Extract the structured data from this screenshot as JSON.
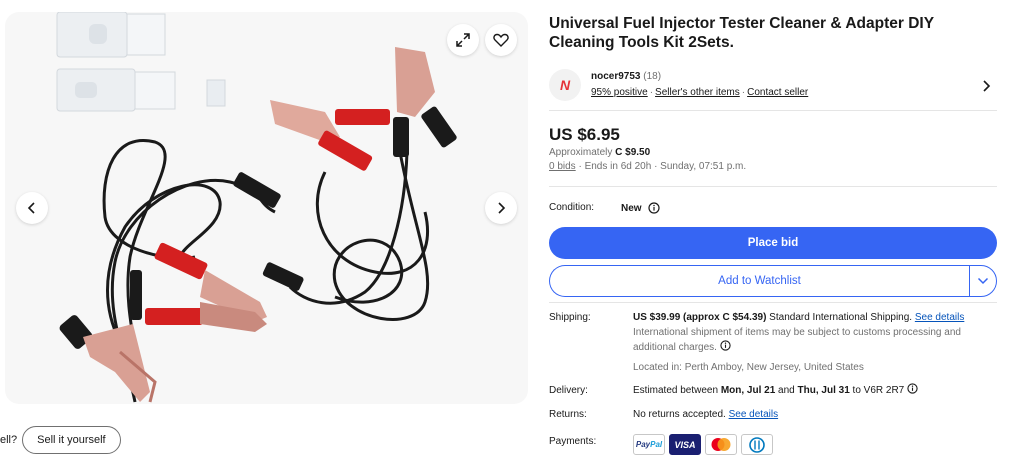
{
  "gallery": {
    "expand_icon": "expand-icon",
    "favorite_icon": "heart-icon",
    "prev_icon": "chevron-left-icon",
    "next_icon": "chevron-right-icon"
  },
  "sell": {
    "prompt": "ell?",
    "button_label": "Sell it yourself"
  },
  "item": {
    "title": "Universal Fuel Injector Tester Cleaner & Adapter DIY Cleaning Tools Kit 2Sets."
  },
  "seller": {
    "logo_letter": "N",
    "name": "nocer9753",
    "feedback_count": "(18)",
    "positive": "95% positive",
    "other_items": "Seller's other items",
    "contact": "Contact seller"
  },
  "price": {
    "amount": "US $6.95",
    "approx_prefix": "Approximately ",
    "approx_value": "C $9.50",
    "bids_link": "0 bids",
    "ends": " · Ends in 6d 20h · Sunday, 07:51 p.m."
  },
  "condition": {
    "label": "Condition:",
    "value": "New"
  },
  "actions": {
    "place_bid": "Place bid",
    "watchlist": "Add to Watchlist"
  },
  "shipping": {
    "label": "Shipping:",
    "cost": "US $39.99 (approx C $54.39)",
    "method": " Standard International Shipping. ",
    "details_link": "See details",
    "customs_note": "International shipment of items may be subject to customs processing and additional charges.",
    "location": "Located in: Perth Amboy, New Jersey, United States"
  },
  "delivery": {
    "label": "Delivery:",
    "prefix": "Estimated between ",
    "start": "Mon, Jul 21",
    "and": " and ",
    "end": "Thu, Jul 31",
    "to": " to V6R 2R7"
  },
  "returns": {
    "label": "Returns:",
    "text": "No returns accepted. ",
    "details_link": "See details"
  },
  "payments": {
    "label": "Payments:",
    "methods": [
      "PayPal",
      "VISA",
      "Mastercard",
      "Diners Club"
    ]
  },
  "colors": {
    "accent": "#3665f3",
    "link": "#0654ba",
    "brand_red": "#e53238"
  }
}
